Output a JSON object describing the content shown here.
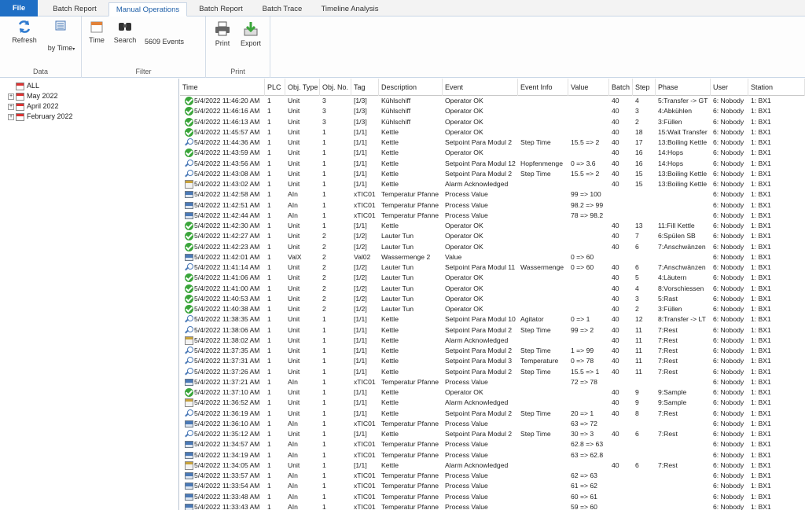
{
  "tabs": {
    "file": "File",
    "batch_report_1": "Batch Report",
    "manual_operations": "Manual Operations",
    "batch_report_2": "Batch Report",
    "batch_trace": "Batch Trace",
    "timeline_analysis": "Timeline Analysis"
  },
  "ribbon": {
    "refresh": "Refresh",
    "by_time": "by Time",
    "data_group": "Data",
    "time": "Time",
    "search": "Search",
    "events": "5609 Events",
    "filter_group": "Filter",
    "print": "Print",
    "export": "Export",
    "print_group": "Print"
  },
  "tree": {
    "all": "ALL",
    "may": "May 2022",
    "april": "April 2022",
    "february": "February 2022"
  },
  "columns": [
    "Time",
    "PLC",
    "Obj. Type",
    "Obj. No.",
    "Tag",
    "Description",
    "Event",
    "Event Info",
    "Value",
    "Batch",
    "Step",
    "Phase",
    "User",
    "Station"
  ],
  "rows": [
    {
      "icon": "ok",
      "c": [
        "5/4/2022 11:46:20 AM",
        "1",
        "Unit",
        "3",
        "[1/3]",
        "Kühlschiff",
        "Operator OK",
        "",
        "",
        "40",
        "4",
        "5:Transfer -> GT",
        "6: Nobody",
        "1: BX1"
      ]
    },
    {
      "icon": "ok",
      "c": [
        "5/4/2022 11:46:16 AM",
        "1",
        "Unit",
        "3",
        "[1/3]",
        "Kühlschiff",
        "Operator OK",
        "",
        "",
        "40",
        "3",
        "4:Abkühlen",
        "6: Nobody",
        "1: BX1"
      ]
    },
    {
      "icon": "ok",
      "c": [
        "5/4/2022 11:46:13 AM",
        "1",
        "Unit",
        "3",
        "[1/3]",
        "Kühlschiff",
        "Operator OK",
        "",
        "",
        "40",
        "2",
        "3:Füllen",
        "6: Nobody",
        "1: BX1"
      ]
    },
    {
      "icon": "ok",
      "c": [
        "5/4/2022 11:45:57 AM",
        "1",
        "Unit",
        "1",
        "[1/1]",
        "Kettle",
        "Operator OK",
        "",
        "",
        "40",
        "18",
        "15:Wait Transfer",
        "6: Nobody",
        "1: BX1"
      ]
    },
    {
      "icon": "sp",
      "c": [
        "5/4/2022 11:44:36 AM",
        "1",
        "Unit",
        "1",
        "[1/1]",
        "Kettle",
        "Setpoint Para Modul 2",
        "Step Time",
        "15.5  =>  2",
        "40",
        "17",
        "13:Boiling Kettle",
        "6: Nobody",
        "1: BX1"
      ]
    },
    {
      "icon": "ok",
      "c": [
        "5/4/2022 11:43:59 AM",
        "1",
        "Unit",
        "1",
        "[1/1]",
        "Kettle",
        "Operator OK",
        "",
        "",
        "40",
        "16",
        "14:Hops",
        "6: Nobody",
        "1: BX1"
      ]
    },
    {
      "icon": "sp",
      "c": [
        "5/4/2022 11:43:56 AM",
        "1",
        "Unit",
        "1",
        "[1/1]",
        "Kettle",
        "Setpoint Para Modul 12",
        "Hopfenmenge",
        "0  =>  3.6",
        "40",
        "16",
        "14:Hops",
        "6: Nobody",
        "1: BX1"
      ]
    },
    {
      "icon": "sp",
      "c": [
        "5/4/2022 11:43:08 AM",
        "1",
        "Unit",
        "1",
        "[1/1]",
        "Kettle",
        "Setpoint Para Modul 2",
        "Step Time",
        "15.5  =>  2",
        "40",
        "15",
        "13:Boiling Kettle",
        "6: Nobody",
        "1: BX1"
      ]
    },
    {
      "icon": "al",
      "c": [
        "5/4/2022 11:43:02 AM",
        "1",
        "Unit",
        "1",
        "[1/1]",
        "Kettle",
        "Alarm Acknowledged",
        "",
        "",
        "40",
        "15",
        "13:Boiling Kettle",
        "6: Nobody",
        "1: BX1"
      ]
    },
    {
      "icon": "pv",
      "c": [
        "5/4/2022 11:42:58 AM",
        "1",
        "AIn",
        "1",
        "xTIC01",
        "Temperatur Pfanne",
        "Process Value",
        "",
        "99  =>  100",
        "",
        "",
        "",
        "6: Nobody",
        "1: BX1"
      ]
    },
    {
      "icon": "pv",
      "c": [
        "5/4/2022 11:42:51 AM",
        "1",
        "AIn",
        "1",
        "xTIC01",
        "Temperatur Pfanne",
        "Process Value",
        "",
        "98.2  =>  99",
        "",
        "",
        "",
        "6: Nobody",
        "1: BX1"
      ]
    },
    {
      "icon": "pv",
      "c": [
        "5/4/2022 11:42:44 AM",
        "1",
        "AIn",
        "1",
        "xTIC01",
        "Temperatur Pfanne",
        "Process Value",
        "",
        "78  =>  98.2",
        "",
        "",
        "",
        "6: Nobody",
        "1: BX1"
      ]
    },
    {
      "icon": "ok",
      "c": [
        "5/4/2022 11:42:30 AM",
        "1",
        "Unit",
        "1",
        "[1/1]",
        "Kettle",
        "Operator OK",
        "",
        "",
        "40",
        "13",
        "11:Fill Kettle",
        "6: Nobody",
        "1: BX1"
      ]
    },
    {
      "icon": "ok",
      "c": [
        "5/4/2022 11:42:27 AM",
        "1",
        "Unit",
        "2",
        "[1/2]",
        "Lauter Tun",
        "Operator OK",
        "",
        "",
        "40",
        "7",
        "6:Spülen SB",
        "6: Nobody",
        "1: BX1"
      ]
    },
    {
      "icon": "ok",
      "c": [
        "5/4/2022 11:42:23 AM",
        "1",
        "Unit",
        "2",
        "[1/2]",
        "Lauter Tun",
        "Operator OK",
        "",
        "",
        "40",
        "6",
        "7:Anschwänzen",
        "6: Nobody",
        "1: BX1"
      ]
    },
    {
      "icon": "pv",
      "c": [
        "5/4/2022 11:42:01 AM",
        "1",
        "ValX",
        "2",
        "Val02",
        "Wassermenge 2",
        "Value",
        "",
        "0  =>  60",
        "",
        "",
        "",
        "6: Nobody",
        "1: BX1"
      ]
    },
    {
      "icon": "sp",
      "c": [
        "5/4/2022 11:41:14 AM",
        "1",
        "Unit",
        "2",
        "[1/2]",
        "Lauter Tun",
        "Setpoint Para Modul 11",
        "Wassermenge",
        "0  =>  60",
        "40",
        "6",
        "7:Anschwänzen",
        "6: Nobody",
        "1: BX1"
      ]
    },
    {
      "icon": "ok",
      "c": [
        "5/4/2022 11:41:06 AM",
        "1",
        "Unit",
        "2",
        "[1/2]",
        "Lauter Tun",
        "Operator OK",
        "",
        "",
        "40",
        "5",
        "4:Läutern",
        "6: Nobody",
        "1: BX1"
      ]
    },
    {
      "icon": "ok",
      "c": [
        "5/4/2022 11:41:00 AM",
        "1",
        "Unit",
        "2",
        "[1/2]",
        "Lauter Tun",
        "Operator OK",
        "",
        "",
        "40",
        "4",
        "8:Vorschiessen",
        "6: Nobody",
        "1: BX1"
      ]
    },
    {
      "icon": "ok",
      "c": [
        "5/4/2022 11:40:53 AM",
        "1",
        "Unit",
        "2",
        "[1/2]",
        "Lauter Tun",
        "Operator OK",
        "",
        "",
        "40",
        "3",
        "5:Rast",
        "6: Nobody",
        "1: BX1"
      ]
    },
    {
      "icon": "ok",
      "c": [
        "5/4/2022 11:40:38 AM",
        "1",
        "Unit",
        "2",
        "[1/2]",
        "Lauter Tun",
        "Operator OK",
        "",
        "",
        "40",
        "2",
        "3:Füllen",
        "6: Nobody",
        "1: BX1"
      ]
    },
    {
      "icon": "sp",
      "c": [
        "5/4/2022 11:38:35 AM",
        "1",
        "Unit",
        "1",
        "[1/1]",
        "Kettle",
        "Setpoint Para Modul 10",
        "Agitator",
        "0  =>  1",
        "40",
        "12",
        "8:Transfer -> LT",
        "6: Nobody",
        "1: BX1"
      ]
    },
    {
      "icon": "sp",
      "c": [
        "5/4/2022 11:38:06 AM",
        "1",
        "Unit",
        "1",
        "[1/1]",
        "Kettle",
        "Setpoint Para Modul 2",
        "Step Time",
        "99  =>  2",
        "40",
        "11",
        "7:Rest",
        "6: Nobody",
        "1: BX1"
      ]
    },
    {
      "icon": "al",
      "c": [
        "5/4/2022 11:38:02 AM",
        "1",
        "Unit",
        "1",
        "[1/1]",
        "Kettle",
        "Alarm Acknowledged",
        "",
        "",
        "40",
        "11",
        "7:Rest",
        "6: Nobody",
        "1: BX1"
      ]
    },
    {
      "icon": "sp",
      "c": [
        "5/4/2022 11:37:35 AM",
        "1",
        "Unit",
        "1",
        "[1/1]",
        "Kettle",
        "Setpoint Para Modul 2",
        "Step Time",
        "1  =>  99",
        "40",
        "11",
        "7:Rest",
        "6: Nobody",
        "1: BX1"
      ]
    },
    {
      "icon": "sp",
      "c": [
        "5/4/2022 11:37:31 AM",
        "1",
        "Unit",
        "1",
        "[1/1]",
        "Kettle",
        "Setpoint Para Modul 3",
        "Temperature",
        "0  =>  78",
        "40",
        "11",
        "7:Rest",
        "6: Nobody",
        "1: BX1"
      ]
    },
    {
      "icon": "sp",
      "c": [
        "5/4/2022 11:37:26 AM",
        "1",
        "Unit",
        "1",
        "[1/1]",
        "Kettle",
        "Setpoint Para Modul 2",
        "Step Time",
        "15.5  =>  1",
        "40",
        "11",
        "7:Rest",
        "6: Nobody",
        "1: BX1"
      ]
    },
    {
      "icon": "pv",
      "c": [
        "5/4/2022 11:37:21 AM",
        "1",
        "AIn",
        "1",
        "xTIC01",
        "Temperatur Pfanne",
        "Process Value",
        "",
        "72  =>  78",
        "",
        "",
        "",
        "6: Nobody",
        "1: BX1"
      ]
    },
    {
      "icon": "ok",
      "c": [
        "5/4/2022 11:37:10 AM",
        "1",
        "Unit",
        "1",
        "[1/1]",
        "Kettle",
        "Operator OK",
        "",
        "",
        "40",
        "9",
        "9:Sample",
        "6: Nobody",
        "1: BX1"
      ]
    },
    {
      "icon": "al",
      "c": [
        "5/4/2022 11:36:52 AM",
        "1",
        "Unit",
        "1",
        "[1/1]",
        "Kettle",
        "Alarm Acknowledged",
        "",
        "",
        "40",
        "9",
        "9:Sample",
        "6: Nobody",
        "1: BX1"
      ]
    },
    {
      "icon": "sp",
      "c": [
        "5/4/2022 11:36:19 AM",
        "1",
        "Unit",
        "1",
        "[1/1]",
        "Kettle",
        "Setpoint Para Modul 2",
        "Step Time",
        "20  =>  1",
        "40",
        "8",
        "7:Rest",
        "6: Nobody",
        "1: BX1"
      ]
    },
    {
      "icon": "pv",
      "c": [
        "5/4/2022 11:36:10 AM",
        "1",
        "AIn",
        "1",
        "xTIC01",
        "Temperatur Pfanne",
        "Process Value",
        "",
        "63  =>  72",
        "",
        "",
        "",
        "6: Nobody",
        "1: BX1"
      ]
    },
    {
      "icon": "sp",
      "c": [
        "5/4/2022 11:35:12 AM",
        "1",
        "Unit",
        "1",
        "[1/1]",
        "Kettle",
        "Setpoint Para Modul 2",
        "Step Time",
        "30  =>  3",
        "40",
        "6",
        "7:Rest",
        "6: Nobody",
        "1: BX1"
      ]
    },
    {
      "icon": "pv",
      "c": [
        "5/4/2022 11:34:57 AM",
        "1",
        "AIn",
        "1",
        "xTIC01",
        "Temperatur Pfanne",
        "Process Value",
        "",
        "62.8  =>  63",
        "",
        "",
        "",
        "6: Nobody",
        "1: BX1"
      ]
    },
    {
      "icon": "pv",
      "c": [
        "5/4/2022 11:34:19 AM",
        "1",
        "AIn",
        "1",
        "xTIC01",
        "Temperatur Pfanne",
        "Process Value",
        "",
        "63  =>  62.8",
        "",
        "",
        "",
        "6: Nobody",
        "1: BX1"
      ]
    },
    {
      "icon": "al",
      "c": [
        "5/4/2022 11:34:05 AM",
        "1",
        "Unit",
        "1",
        "[1/1]",
        "Kettle",
        "Alarm Acknowledged",
        "",
        "",
        "40",
        "6",
        "7:Rest",
        "6: Nobody",
        "1: BX1"
      ]
    },
    {
      "icon": "pv",
      "c": [
        "5/4/2022 11:33:57 AM",
        "1",
        "AIn",
        "1",
        "xTIC01",
        "Temperatur Pfanne",
        "Process Value",
        "",
        "62  =>  63",
        "",
        "",
        "",
        "6: Nobody",
        "1: BX1"
      ]
    },
    {
      "icon": "pv",
      "c": [
        "5/4/2022 11:33:54 AM",
        "1",
        "AIn",
        "1",
        "xTIC01",
        "Temperatur Pfanne",
        "Process Value",
        "",
        "61  =>  62",
        "",
        "",
        "",
        "6: Nobody",
        "1: BX1"
      ]
    },
    {
      "icon": "pv",
      "c": [
        "5/4/2022 11:33:48 AM",
        "1",
        "AIn",
        "1",
        "xTIC01",
        "Temperatur Pfanne",
        "Process Value",
        "",
        "60  =>  61",
        "",
        "",
        "",
        "6: Nobody",
        "1: BX1"
      ]
    },
    {
      "icon": "pv",
      "c": [
        "5/4/2022 11:33:43 AM",
        "1",
        "AIn",
        "1",
        "xTIC01",
        "Temperatur Pfanne",
        "Process Value",
        "",
        "59  =>  60",
        "",
        "",
        "",
        "6: Nobody",
        "1: BX1"
      ]
    }
  ]
}
